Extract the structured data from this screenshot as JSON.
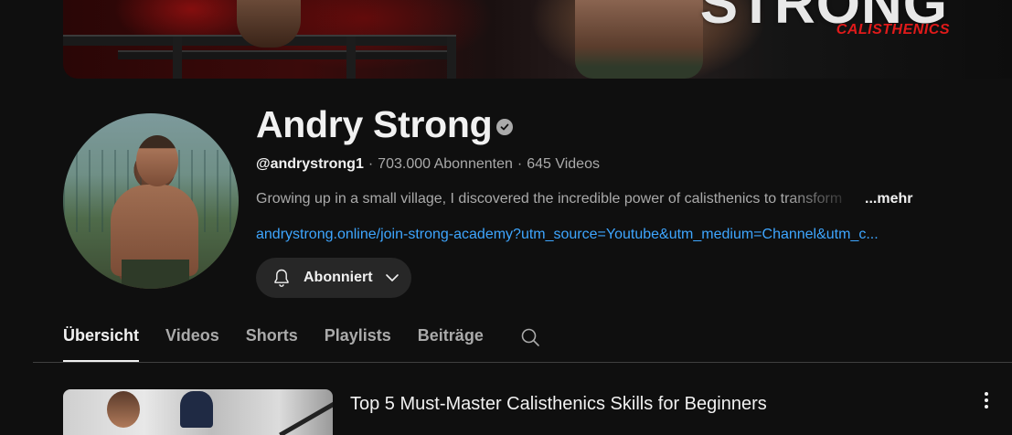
{
  "banner": {
    "brand_title": "STRONG",
    "brand_subtitle": "CALISTHENICS"
  },
  "channel": {
    "name": "Andry Strong",
    "handle": "@andrystrong1",
    "separator": "·",
    "subscribers": "703.000 Abonnenten",
    "video_count": "645 Videos",
    "description": "Growing up in a small village, I discovered the incredible power of calisthenics to transform",
    "more_label": "...mehr",
    "link": "andrystrong.online/join-strong-academy?utm_source=Youtube&utm_medium=Channel&utm_c..."
  },
  "subscribe_button": {
    "label": "Abonniert",
    "icon": "bell-icon"
  },
  "tabs": [
    {
      "label": "Übersicht",
      "active": true
    },
    {
      "label": "Videos",
      "active": false
    },
    {
      "label": "Shorts",
      "active": false
    },
    {
      "label": "Playlists",
      "active": false
    },
    {
      "label": "Beiträge",
      "active": false
    }
  ],
  "featured_video": {
    "title": "Top 5 Must-Master Calisthenics Skills for Beginners"
  },
  "colors": {
    "background": "#0f0f0f",
    "text_primary": "#f1f1f1",
    "text_secondary": "#aaaaaa",
    "link": "#3ea6ff",
    "button_bg": "#272727",
    "brand_red": "#e01a1a"
  }
}
